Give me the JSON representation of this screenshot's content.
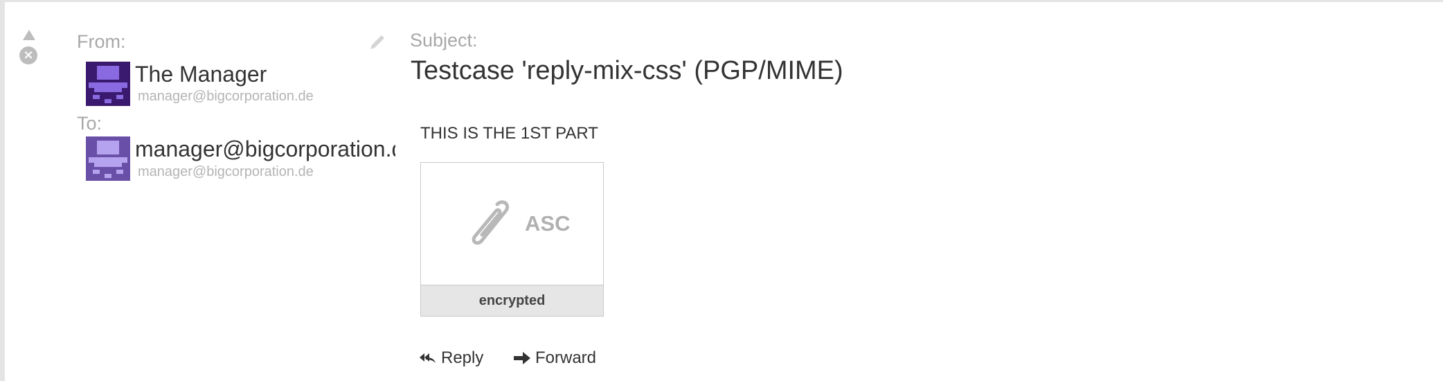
{
  "header": {
    "from_label": "From:",
    "to_label": "To:",
    "subject_label": "Subject:"
  },
  "from": {
    "name": "The Manager",
    "email": "manager@bigcorporation.de",
    "avatar_color": "#3a1a6e"
  },
  "to": {
    "name": "manager@bigcorporation.de",
    "email": "manager@bigcorporation.de",
    "avatar_color": "#6a4fa8"
  },
  "subject": "Testcase 'reply-mix-css' (PGP/MIME)",
  "body": {
    "text": "THIS IS THE 1ST PART"
  },
  "attachment": {
    "extension": "ASC",
    "name": "encrypted"
  },
  "actions": {
    "reply_label": "Reply",
    "forward_label": "Forward"
  },
  "icons": {
    "collapse": "triangle-up-icon",
    "close": "close-icon",
    "edit": "pencil-icon",
    "attachment": "paperclip-icon",
    "reply": "reply-icon",
    "forward": "forward-arrow-icon"
  }
}
